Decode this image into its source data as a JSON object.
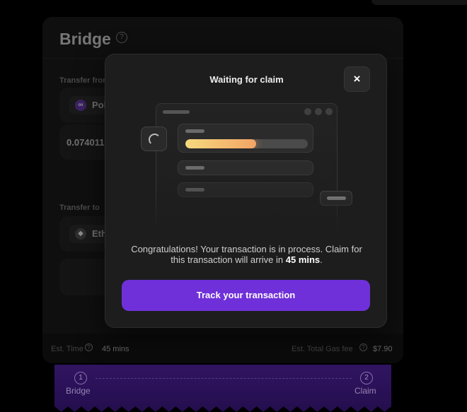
{
  "bridge": {
    "title": "Bridge",
    "help_glyph": "?",
    "transfer_from_label": "Transfer from",
    "from_chain": "Polygon",
    "amount": "0.074011",
    "transfer_to_label": "Transfer to",
    "to_chain": "Ethereum",
    "est_time_label": "Est. Time",
    "est_time_value": "45 mins",
    "gas_label": "Est. Total Gas fee",
    "gas_value": "$7.90"
  },
  "steps": [
    {
      "number": "1",
      "label": "Bridge"
    },
    {
      "number": "2",
      "label": "Claim"
    }
  ],
  "modal": {
    "title": "Waiting for claim",
    "close_glyph": "×",
    "message_before": "Congratulations! Your transaction is in process. Claim for this transaction will arrive in ",
    "message_emphasis": "45 mins",
    "message_after": ".",
    "progress_fraction": 0.58,
    "button_label": "Track your transaction"
  },
  "colors": {
    "accent": "#6f30d9",
    "progress_start": "#f6d97e",
    "progress_end": "#f2a465",
    "background": "#000000",
    "modal": "#1d1d1d"
  },
  "icons": {
    "help": "help-circle-icon",
    "close": "close-icon",
    "loading": "spinner-icon",
    "polygon": "polygon-chain-icon",
    "ethereum": "ethereum-chain-icon"
  }
}
